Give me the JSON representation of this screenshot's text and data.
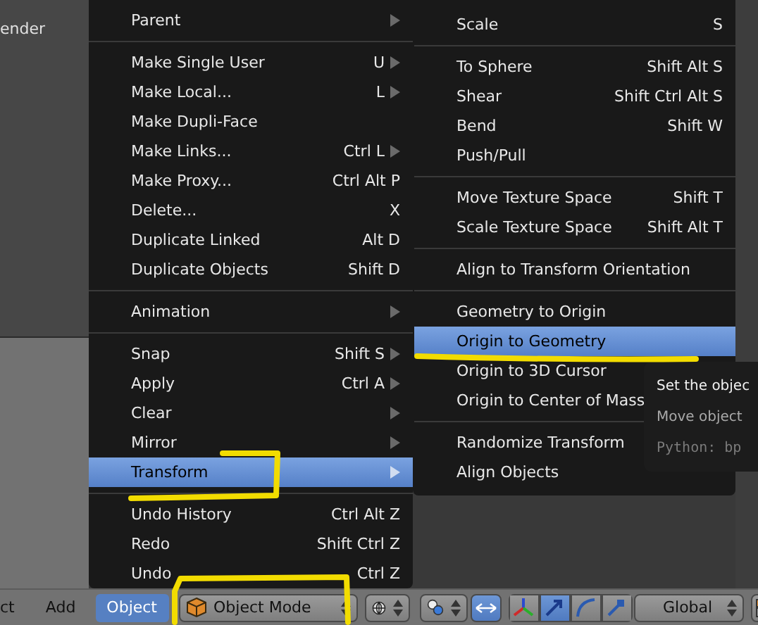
{
  "side_panel": {
    "label": "ender"
  },
  "object_menu": {
    "items": [
      {
        "kind": "item",
        "label": "Parent",
        "submenu": true,
        "selected": false
      },
      {
        "kind": "separator"
      },
      {
        "kind": "item",
        "label": "Make Single User",
        "shortcut": "U",
        "submenu": true,
        "selected": false
      },
      {
        "kind": "item",
        "label": "Make Local...",
        "shortcut": "L",
        "submenu": true,
        "selected": false
      },
      {
        "kind": "item",
        "label": "Make Dupli-Face",
        "submenu": false,
        "selected": false
      },
      {
        "kind": "item",
        "label": "Make Links...",
        "shortcut": "Ctrl L",
        "submenu": true,
        "selected": false
      },
      {
        "kind": "item",
        "label": "Make Proxy...",
        "shortcut": "Ctrl Alt P",
        "submenu": false,
        "selected": false
      },
      {
        "kind": "item",
        "label": "Delete...",
        "shortcut": "X",
        "submenu": false,
        "selected": false
      },
      {
        "kind": "item",
        "label": "Duplicate Linked",
        "shortcut": "Alt D",
        "submenu": false,
        "selected": false
      },
      {
        "kind": "item",
        "label": "Duplicate Objects",
        "shortcut": "Shift D",
        "submenu": false,
        "selected": false
      },
      {
        "kind": "separator"
      },
      {
        "kind": "item",
        "label": "Animation",
        "submenu": true,
        "selected": false
      },
      {
        "kind": "separator"
      },
      {
        "kind": "item",
        "label": "Snap",
        "shortcut": "Shift S",
        "submenu": true,
        "selected": false
      },
      {
        "kind": "item",
        "label": "Apply",
        "shortcut": "Ctrl A",
        "submenu": true,
        "selected": false
      },
      {
        "kind": "item",
        "label": "Clear",
        "submenu": true,
        "selected": false
      },
      {
        "kind": "item",
        "label": "Mirror",
        "submenu": true,
        "selected": false
      },
      {
        "kind": "item",
        "label": "Transform",
        "submenu": true,
        "selected": true
      },
      {
        "kind": "separator"
      },
      {
        "kind": "item",
        "label": "Undo History",
        "shortcut": "Ctrl Alt Z",
        "submenu": false,
        "selected": false
      },
      {
        "kind": "item",
        "label": "Redo",
        "shortcut": "Shift Ctrl Z",
        "submenu": false,
        "selected": false
      },
      {
        "kind": "item",
        "label": "Undo",
        "shortcut": "Ctrl Z",
        "submenu": false,
        "selected": false
      }
    ]
  },
  "transform_menu": {
    "items": [
      {
        "kind": "item",
        "label": "Scale",
        "shortcut": "S",
        "selected": false
      },
      {
        "kind": "separator"
      },
      {
        "kind": "item",
        "label": "To Sphere",
        "shortcut": "Shift Alt S",
        "selected": false
      },
      {
        "kind": "item",
        "label": "Shear",
        "shortcut": "Shift Ctrl Alt S",
        "selected": false
      },
      {
        "kind": "item",
        "label": "Bend",
        "shortcut": "Shift W",
        "selected": false
      },
      {
        "kind": "item",
        "label": "Push/Pull",
        "selected": false
      },
      {
        "kind": "separator"
      },
      {
        "kind": "item",
        "label": "Move Texture Space",
        "shortcut": "Shift T",
        "selected": false
      },
      {
        "kind": "item",
        "label": "Scale Texture Space",
        "shortcut": "Shift Alt T",
        "selected": false
      },
      {
        "kind": "separator"
      },
      {
        "kind": "item",
        "label": "Align to Transform Orientation",
        "selected": false
      },
      {
        "kind": "separator"
      },
      {
        "kind": "item",
        "label": "Geometry to Origin",
        "selected": false
      },
      {
        "kind": "item",
        "label": "Origin to Geometry",
        "selected": true
      },
      {
        "kind": "item",
        "label": "Origin to 3D Cursor",
        "selected": false
      },
      {
        "kind": "item",
        "label": "Origin to Center of Mass",
        "selected": false
      },
      {
        "kind": "separator"
      },
      {
        "kind": "item",
        "label": "Randomize Transform",
        "selected": false
      },
      {
        "kind": "item",
        "label": "Align Objects",
        "selected": false
      }
    ]
  },
  "tooltip": {
    "title": "Set the objec",
    "description": "Move object",
    "python": "Python: bp"
  },
  "header": {
    "menus": [
      {
        "label": "ct",
        "selected": false
      },
      {
        "label": "Add",
        "selected": false
      },
      {
        "label": "Object",
        "selected": true
      }
    ],
    "mode": "Object Mode",
    "orientation": "Global"
  }
}
